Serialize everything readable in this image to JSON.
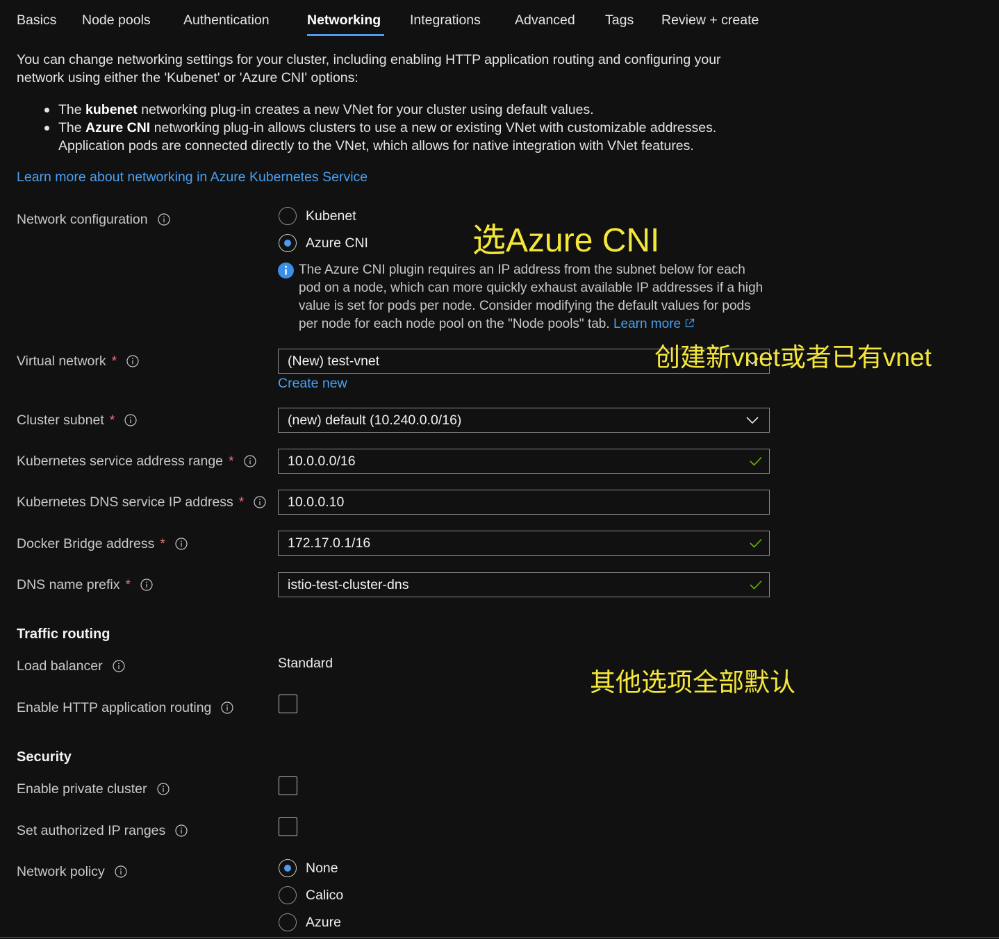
{
  "tabs": {
    "items": [
      "Basics",
      "Node pools",
      "Authentication",
      "Networking",
      "Integrations",
      "Advanced",
      "Tags",
      "Review + create"
    ],
    "active_index": 3
  },
  "intro": {
    "lines": [
      "You can change networking settings for your cluster, including enabling HTTP application routing and configuring your",
      "network using either the 'Kubenet' or 'Azure CNI' options:"
    ],
    "bullets": [
      {
        "before": "The",
        "bold": "kubenet",
        "after": "networking plug-in creates a new VNet for your cluster using default values."
      },
      {
        "before": "The",
        "bold": "Azure CNI",
        "after": "networking plug-in allows clusters to use a new or existing VNet with customizable addresses.",
        "continuation": "Application pods are connected directly to the VNet, which allows for native integration with VNet features."
      }
    ],
    "learn_more_link": "Learn more about networking in Azure Kubernetes Service"
  },
  "required_marker": "*",
  "network_configuration": {
    "label": "Network configuration",
    "options": [
      {
        "label": "Kubenet",
        "selected": false
      },
      {
        "label": "Azure CNI",
        "selected": true
      }
    ],
    "info": {
      "lines": [
        "The Azure CNI plugin requires an IP address from the subnet below for each",
        "pod on a node, which can more quickly exhaust available IP addresses if a high",
        "value is set for pods per node. Consider modifying the default values for pods",
        "per node for each node pool on the \"Node pools\" tab."
      ],
      "link": "Learn more"
    }
  },
  "fields": {
    "virtual_network": {
      "label": "Virtual network",
      "value": "(New) test-vnet",
      "create_new": "Create new"
    },
    "cluster_subnet": {
      "label": "Cluster subnet",
      "value": "(new) default (10.240.0.0/16)"
    },
    "service_address_range": {
      "label": "Kubernetes service address range",
      "value": "10.0.0.0/16",
      "valid": true
    },
    "dns_service_ip": {
      "label": "Kubernetes DNS service IP address",
      "value": "10.0.0.10",
      "valid": false
    },
    "docker_bridge": {
      "label": "Docker Bridge address",
      "value": "172.17.0.1/16",
      "valid": true
    },
    "dns_name_prefix": {
      "label": "DNS name prefix",
      "value": "istio-test-cluster-dns",
      "valid": true
    }
  },
  "traffic_routing": {
    "heading": "Traffic routing",
    "load_balancer": {
      "label": "Load balancer",
      "value": "Standard"
    },
    "http_routing": {
      "label": "Enable HTTP application routing",
      "checked": false
    }
  },
  "security": {
    "heading": "Security",
    "private_cluster": {
      "label": "Enable private cluster",
      "checked": false
    },
    "authorized_ip_ranges": {
      "label": "Set authorized IP ranges",
      "checked": false
    },
    "network_policy": {
      "label": "Network policy",
      "options": [
        {
          "label": "None",
          "selected": true
        },
        {
          "label": "Calico",
          "selected": false
        },
        {
          "label": "Azure",
          "selected": false
        }
      ]
    }
  },
  "annotations": {
    "choose_cni": "选Azure CNI",
    "vnet_note": "创建新vnet或者已有vnet",
    "defaults_note": "其他选项全部默认"
  },
  "icons": [
    "info-icon",
    "info-filled-icon",
    "external-link-icon",
    "chevron-down-icon",
    "checkmark-icon"
  ],
  "colors": {
    "background": "#111111",
    "accent": "#4f9bf0",
    "link": "#4aa0f0",
    "required": "#f1707b",
    "valid": "#6bb700",
    "annotation": "#f5e73a"
  }
}
